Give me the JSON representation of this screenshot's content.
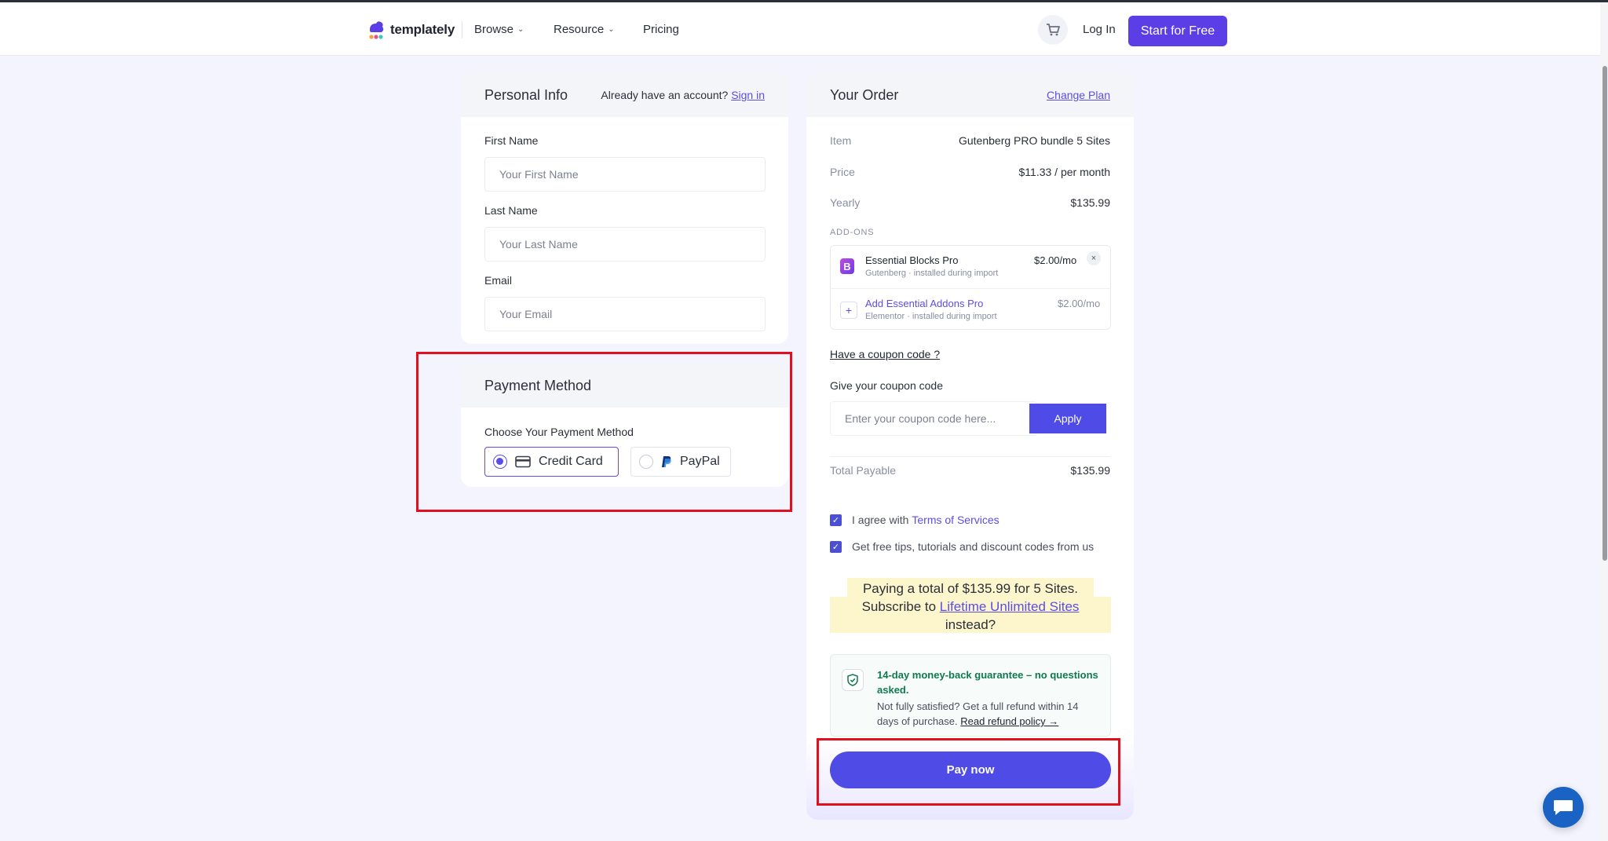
{
  "nav": {
    "brand": "templately",
    "browse": "Browse",
    "resource": "Resource",
    "pricing": "Pricing",
    "login": "Log In",
    "start": "Start for Free"
  },
  "personal": {
    "title": "Personal Info",
    "account_prompt": "Already have an account?",
    "signin": "Sign in",
    "first_name_label": "First Name",
    "first_name_placeholder": "Your First Name",
    "last_name_label": "Last Name",
    "last_name_placeholder": "Your Last Name",
    "email_label": "Email",
    "email_placeholder": "Your Email"
  },
  "payment": {
    "title": "Payment Method",
    "choose_label": "Choose Your Payment Method",
    "options": [
      {
        "label": "Credit Card",
        "selected": true
      },
      {
        "label": "PayPal",
        "selected": false
      }
    ]
  },
  "order": {
    "title": "Your Order",
    "change_plan": "Change Plan",
    "item_key": "Item",
    "item_value": "Gutenberg PRO bundle 5 Sites",
    "price_key": "Price",
    "price_value": "$11.33 / per month",
    "yearly_key": "Yearly",
    "yearly_value": "$135.99",
    "addons_heading": "ADD-ONS",
    "addons": [
      {
        "name": "Essential Blocks Pro",
        "sub": "Gutenberg · installed during import",
        "price": "$2.00/mo",
        "added": true
      },
      {
        "name": "Add Essential Addons Pro",
        "sub": "Elementor · installed during import",
        "price": "$2.00/mo",
        "added": false
      }
    ],
    "coupon_toggle": "Have a coupon code ?",
    "coupon_label": "Give your coupon code",
    "coupon_placeholder": "Enter your coupon code here...",
    "apply": "Apply",
    "total_key": "Total Payable",
    "total_value": "$135.99",
    "agree_prefix": "I agree with",
    "agree_link": "Terms of Services",
    "tips": "Get free tips, tutorials and discount codes from us",
    "upsell_line1": "Paying a total of $135.99 for 5 Sites.",
    "upsell_prefix": "Subscribe to",
    "upsell_link": "Lifetime Unlimited Sites",
    "upsell_suffix": "instead?",
    "guarantee_title": "14-day money-back guarantee – no questions asked.",
    "guarantee_text": "Not fully satisfied? Get a full refund within 14 days of purchase.",
    "refund_link": "Read refund policy →",
    "pay_now": "Pay now"
  },
  "colors": {
    "accent": "#5b4de6",
    "highlight": "#e2101f",
    "guarantee_green": "#0f7a4f"
  }
}
